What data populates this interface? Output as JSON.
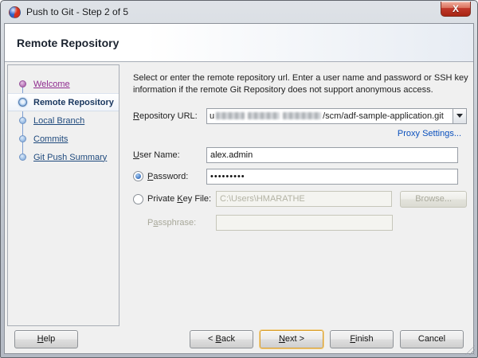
{
  "window": {
    "title": "Push to Git - Step 2 of 5",
    "close_glyph": "X"
  },
  "header": {
    "title": "Remote Repository"
  },
  "sidebar": {
    "steps": [
      {
        "label": "Welcome",
        "state": "visited"
      },
      {
        "label": "Remote Repository",
        "state": "current"
      },
      {
        "label": "Local Branch",
        "state": "pending"
      },
      {
        "label": "Commits",
        "state": "pending"
      },
      {
        "label": "Git Push Summary",
        "state": "pending"
      }
    ]
  },
  "main": {
    "instructions": "Select or enter the remote repository url. Enter a user name and password or SSH key information if the remote Git Repository does not support anonymous access.",
    "repository_url": {
      "label_mn": "R",
      "label_post": "epository URL:",
      "value_prefix": "u",
      "value_suffix": "/scm/adf-sample-application.git",
      "redacted": true
    },
    "proxy_settings_link": "Proxy Settings...",
    "user_name": {
      "label_mn": "U",
      "label_post": "ser Name:",
      "value": "alex.admin"
    },
    "password": {
      "label_mn": "P",
      "label_post": "assword:",
      "masked_value": "•••••••••",
      "selected": true
    },
    "private_key_file": {
      "label_pre": "Private ",
      "label_mn": "K",
      "label_post": "ey File:",
      "value": "C:\\Users\\HMARATHE",
      "browse_label": "Browse...",
      "enabled": false
    },
    "passphrase": {
      "label_pre": "P",
      "label_mn": "a",
      "label_post": "ssphrase:",
      "value": "",
      "enabled": false
    }
  },
  "footer": {
    "help": {
      "label_mn": "H",
      "label_post": "elp"
    },
    "back": {
      "label_pre": "< ",
      "label_mn": "B",
      "label_post": "ack"
    },
    "next": {
      "label_mn": "N",
      "label_post": "ext >"
    },
    "finish": {
      "label_mn": "F",
      "label_post": "inish"
    },
    "cancel": {
      "label": "Cancel"
    }
  },
  "colors": {
    "link_blue": "#0a50bd",
    "visited_purple": "#8e2a8e",
    "step_link_navy": "#1f4a7d",
    "focus_ring_orange": "#d9a032",
    "close_button_red": "#c0392b"
  }
}
